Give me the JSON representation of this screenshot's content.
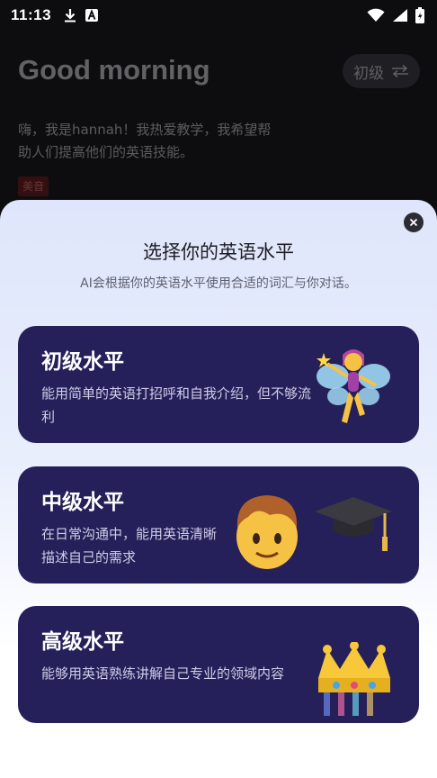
{
  "status_bar": {
    "time": "11:13",
    "left_icons": [
      "download-icon",
      "font-a-icon"
    ],
    "right_icons": [
      "wifi-icon",
      "signal-icon",
      "battery-icon"
    ]
  },
  "background_page": {
    "greeting": "Good morning",
    "level_pill": {
      "label": "初级",
      "icon": "swap-arrows-icon"
    },
    "intro_text": "嗨，我是hannah！我热爱教学，我希望帮助人们提高他们的英语技能。",
    "accent_tag": "美音"
  },
  "sheet": {
    "title": "选择你的英语水平",
    "subtitle": "AI会根据你的英语水平使用合适的词汇与你对话。",
    "close_icon": "close-icon",
    "levels": [
      {
        "title": "初级水平",
        "desc": "能用简单的英语打招呼和自我介绍，但不够流利",
        "art": "fairy-icon"
      },
      {
        "title": "中级水平",
        "desc": "在日常沟通中，能用英语清晰描述自己的需求",
        "art": [
          "boy-face-icon",
          "graduation-cap-icon"
        ]
      },
      {
        "title": "高级水平",
        "desc": "能够用英语熟练讲解自己专业的领域内容",
        "art": "crown-icon"
      }
    ]
  },
  "colors": {
    "card_bg": "#25205a",
    "sheet_top": "#dfe6fb",
    "page_bg": "#0d0d10"
  }
}
